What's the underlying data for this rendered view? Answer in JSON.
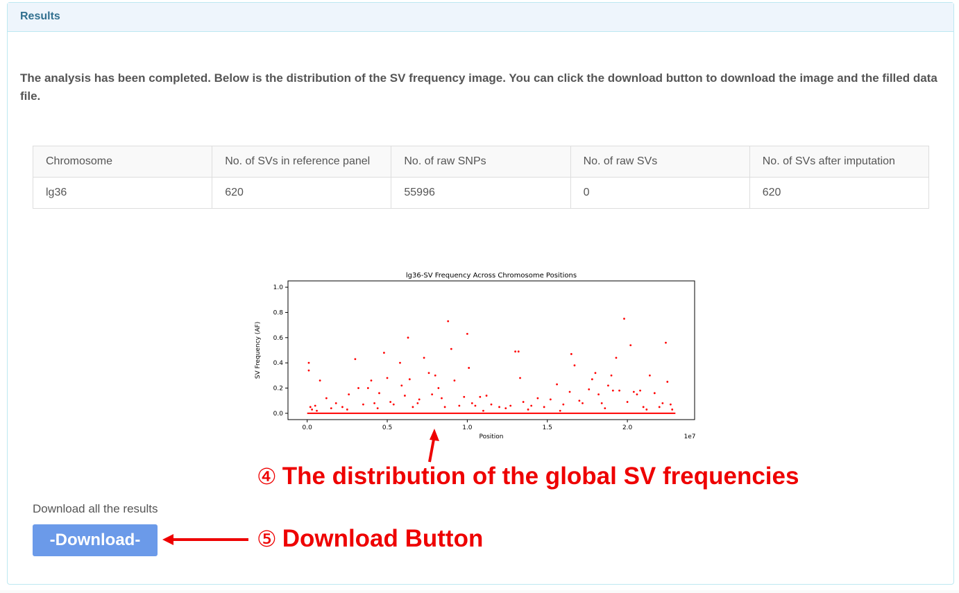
{
  "panel": {
    "heading": "Results",
    "message": "The analysis has been completed. Below is the distribution of the SV frequency image. You can click the download button to download the image and the filled data file."
  },
  "table": {
    "headers": [
      "Chromosome",
      "No. of SVs in reference panel",
      "No. of raw SNPs",
      "No. of raw SVs",
      "No. of SVs after imputation"
    ],
    "row": [
      "lg36",
      "620",
      "55996",
      "0",
      "620"
    ]
  },
  "chart_data": {
    "type": "scatter",
    "title": "lg36-SV Frequency Across Chromosome Positions",
    "xlabel": "Position",
    "ylabel": "SV Frequency (AF)",
    "x_offset_label": "1e7",
    "xlim": [
      -0.12,
      2.42
    ],
    "ylim": [
      -0.05,
      1.05
    ],
    "xticks": [
      "0.0",
      "0.5",
      "1.0",
      "1.5",
      "2.0"
    ],
    "yticks": [
      "0.0",
      "0.2",
      "0.4",
      "0.6",
      "0.8",
      "1.0"
    ],
    "color": "#ff0000",
    "points": [
      [
        0.01,
        0.4
      ],
      [
        0.01,
        0.34
      ],
      [
        0.02,
        0.05
      ],
      [
        0.03,
        0.03
      ],
      [
        0.05,
        0.06
      ],
      [
        0.06,
        0.02
      ],
      [
        0.08,
        0.26
      ],
      [
        0.12,
        0.12
      ],
      [
        0.15,
        0.04
      ],
      [
        0.18,
        0.08
      ],
      [
        0.22,
        0.05
      ],
      [
        0.26,
        0.15
      ],
      [
        0.3,
        0.43
      ],
      [
        0.32,
        0.2
      ],
      [
        0.35,
        0.07
      ],
      [
        0.38,
        0.2
      ],
      [
        0.4,
        0.26
      ],
      [
        0.42,
        0.08
      ],
      [
        0.45,
        0.16
      ],
      [
        0.48,
        0.48
      ],
      [
        0.5,
        0.28
      ],
      [
        0.52,
        0.09
      ],
      [
        0.54,
        0.07
      ],
      [
        0.58,
        0.4
      ],
      [
        0.59,
        0.22
      ],
      [
        0.61,
        0.14
      ],
      [
        0.63,
        0.6
      ],
      [
        0.64,
        0.27
      ],
      [
        0.66,
        0.05
      ],
      [
        0.69,
        0.08
      ],
      [
        0.73,
        0.44
      ],
      [
        0.76,
        0.32
      ],
      [
        0.78,
        0.15
      ],
      [
        0.8,
        0.3
      ],
      [
        0.82,
        0.2
      ],
      [
        0.84,
        0.12
      ],
      [
        0.86,
        0.05
      ],
      [
        0.88,
        0.73
      ],
      [
        0.9,
        0.51
      ],
      [
        0.92,
        0.26
      ],
      [
        0.95,
        0.06
      ],
      [
        0.98,
        0.13
      ],
      [
        1.0,
        0.63
      ],
      [
        1.01,
        0.36
      ],
      [
        1.03,
        0.08
      ],
      [
        1.05,
        0.06
      ],
      [
        1.08,
        0.13
      ],
      [
        1.12,
        0.14
      ],
      [
        1.15,
        0.07
      ],
      [
        1.2,
        0.05
      ],
      [
        1.24,
        0.04
      ],
      [
        1.27,
        0.06
      ],
      [
        1.3,
        0.49
      ],
      [
        1.32,
        0.49
      ],
      [
        1.33,
        0.28
      ],
      [
        1.35,
        0.09
      ],
      [
        1.4,
        0.06
      ],
      [
        1.44,
        0.12
      ],
      [
        1.48,
        0.05
      ],
      [
        1.52,
        0.11
      ],
      [
        1.56,
        0.23
      ],
      [
        1.6,
        0.07
      ],
      [
        1.64,
        0.17
      ],
      [
        1.65,
        0.47
      ],
      [
        1.67,
        0.38
      ],
      [
        1.7,
        0.1
      ],
      [
        1.72,
        0.08
      ],
      [
        1.76,
        0.19
      ],
      [
        1.78,
        0.27
      ],
      [
        1.8,
        0.32
      ],
      [
        1.82,
        0.15
      ],
      [
        1.84,
        0.08
      ],
      [
        1.88,
        0.22
      ],
      [
        1.9,
        0.3
      ],
      [
        1.91,
        0.18
      ],
      [
        1.93,
        0.44
      ],
      [
        1.95,
        0.18
      ],
      [
        1.98,
        0.75
      ],
      [
        2.0,
        0.09
      ],
      [
        2.02,
        0.54
      ],
      [
        2.04,
        0.17
      ],
      [
        2.06,
        0.15
      ],
      [
        2.08,
        0.18
      ],
      [
        2.1,
        0.05
      ],
      [
        2.14,
        0.3
      ],
      [
        2.17,
        0.16
      ],
      [
        2.2,
        0.05
      ],
      [
        2.22,
        0.08
      ],
      [
        2.24,
        0.56
      ],
      [
        2.25,
        0.25
      ],
      [
        2.27,
        0.07
      ],
      [
        2.28,
        0.03
      ],
      [
        0.44,
        0.04
      ],
      [
        0.7,
        0.11
      ],
      [
        1.1,
        0.02
      ],
      [
        1.38,
        0.03
      ],
      [
        1.86,
        0.04
      ],
      [
        2.12,
        0.03
      ],
      [
        0.25,
        0.03
      ],
      [
        1.58,
        0.02
      ]
    ],
    "baseline": {
      "y": 0.0,
      "from": 0.0,
      "to": 2.3
    }
  },
  "download": {
    "label": "Download all the results",
    "button": "-Download-"
  },
  "annotations": {
    "ann4_num": "④",
    "ann4_text": "The distribution of the global SV frequencies",
    "ann5_num": "⑤",
    "ann5_text": "Download Button"
  }
}
